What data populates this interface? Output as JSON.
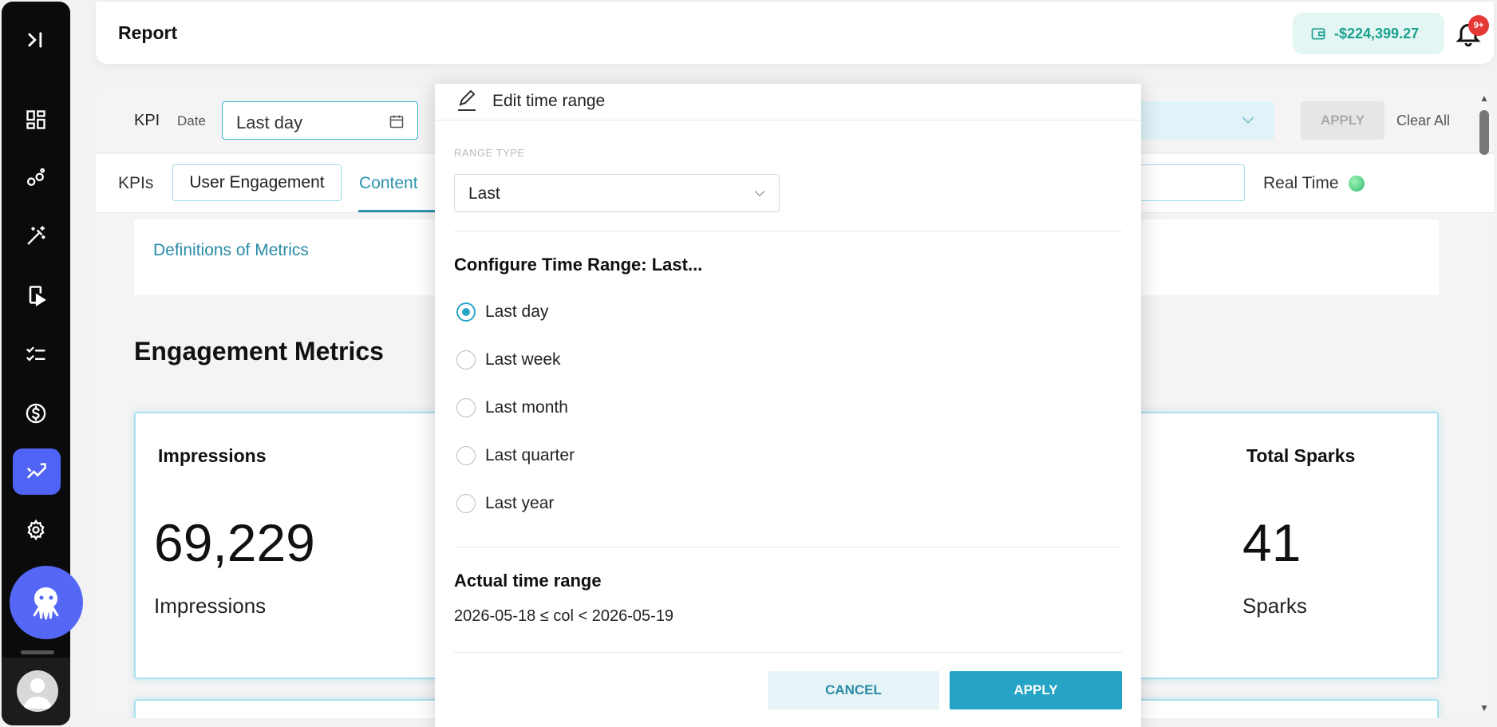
{
  "sidebar": {
    "items": [
      {
        "icon": "expand-panel-icon"
      },
      {
        "icon": "dashboard-icon"
      },
      {
        "icon": "nodes-icon"
      },
      {
        "icon": "magic-wand-icon"
      },
      {
        "icon": "mobile-play-icon"
      },
      {
        "icon": "checklist-icon"
      },
      {
        "icon": "dollar-icon"
      },
      {
        "icon": "analytics-icon",
        "active": true
      },
      {
        "icon": "gear-icon"
      }
    ],
    "assistant_icon": "octopus-icon",
    "user_icon": "user-avatar-icon"
  },
  "header": {
    "title": "Report",
    "balance": "-$224,399.27",
    "notification_badge": "9+"
  },
  "filters": {
    "kpi_label": "KPI",
    "date_label": "Date",
    "date_value": "Last day",
    "apply_label": "APPLY",
    "clear_label": "Clear All"
  },
  "tabs": {
    "kpis": "KPIs",
    "engagement": "User Engagement",
    "content": "Content",
    "realtime": "Real Time"
  },
  "definitions_link": "Definitions of Metrics",
  "section_title": "Engagement Metrics",
  "metrics": [
    {
      "title": "Impressions",
      "value": "69,229",
      "unit": "Impressions"
    },
    {
      "title": "Total Sparks",
      "value": "41",
      "unit": "Sparks"
    }
  ],
  "modal": {
    "title": "Edit time range",
    "range_type_label": "RANGE TYPE",
    "range_type_value": "Last",
    "config_title": "Configure Time Range: Last...",
    "options": [
      {
        "label": "Last day",
        "checked": true
      },
      {
        "label": "Last week",
        "checked": false
      },
      {
        "label": "Last month",
        "checked": false
      },
      {
        "label": "Last quarter",
        "checked": false
      },
      {
        "label": "Last year",
        "checked": false
      }
    ],
    "actual_title": "Actual time range",
    "actual_value": "2026-05-18 ≤ col < 2026-05-19",
    "cancel_label": "CANCEL",
    "apply_label": "APPLY"
  },
  "colors": {
    "accent": "#25a4c6",
    "sidebar_active": "#4f63f5",
    "balance_text": "#1aa18e",
    "badge": "#e53935"
  }
}
